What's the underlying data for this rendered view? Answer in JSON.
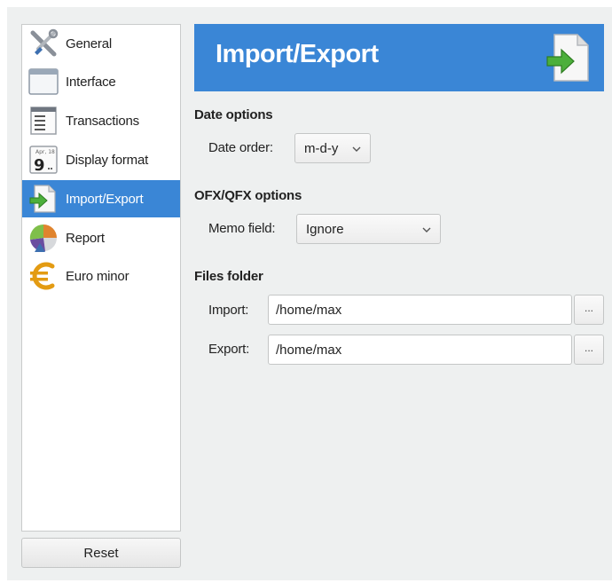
{
  "sidebar": {
    "items": [
      {
        "label": "General",
        "icon": "tools-icon"
      },
      {
        "label": "Interface",
        "icon": "window-icon"
      },
      {
        "label": "Transactions",
        "icon": "document-lines-icon"
      },
      {
        "label": "Display format",
        "icon": "calendar-icon"
      },
      {
        "label": "Import/Export",
        "icon": "import-export-icon",
        "selected": true
      },
      {
        "label": "Report",
        "icon": "pie-chart-icon"
      },
      {
        "label": "Euro minor",
        "icon": "euro-icon"
      }
    ],
    "calendar_month": "Apr, 18",
    "calendar_day": "9"
  },
  "reset_label": "Reset",
  "header": {
    "title": "Import/Export"
  },
  "date_options": {
    "title": "Date options",
    "date_order_label": "Date order:",
    "date_order_value": "m-d-y"
  },
  "ofx_options": {
    "title": "OFX/QFX options",
    "memo_label": "Memo field:",
    "memo_value": "Ignore"
  },
  "files_folder": {
    "title": "Files folder",
    "import_label": "Import:",
    "import_value": "/home/max",
    "export_label": "Export:",
    "export_value": "/home/max",
    "browse_label": "..."
  },
  "colors": {
    "accent": "#3a86d6",
    "window_bg": "#eef0f0"
  }
}
